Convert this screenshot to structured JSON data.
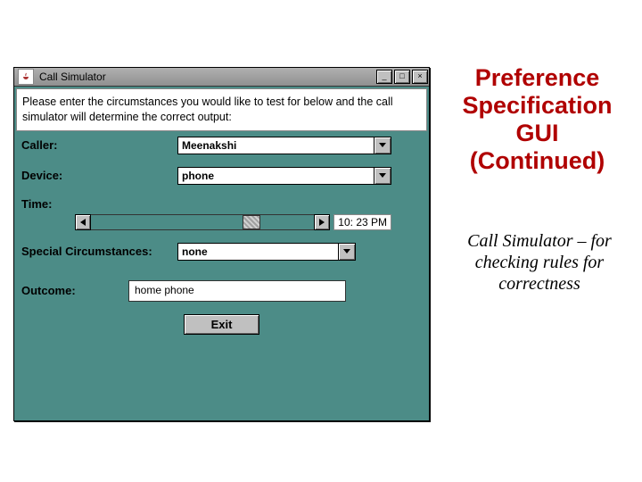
{
  "slide": {
    "title": "Preference Specification GUI (Continued)",
    "subtitle": "Call Simulator – for checking rules for correctness"
  },
  "window": {
    "title": "Call Simulator",
    "instructions": "Please enter the circumstances you would like to test for below and the call simulator will determine the correct output:",
    "labels": {
      "caller": "Caller:",
      "device": "Device:",
      "time": "Time:",
      "special": "Special Circumstances:",
      "outcome": "Outcome:"
    },
    "values": {
      "caller": "Meenakshi",
      "device": "phone",
      "time": "10: 23 PM",
      "special": "none",
      "outcome": "home phone"
    },
    "buttons": {
      "exit": "Exit"
    }
  }
}
